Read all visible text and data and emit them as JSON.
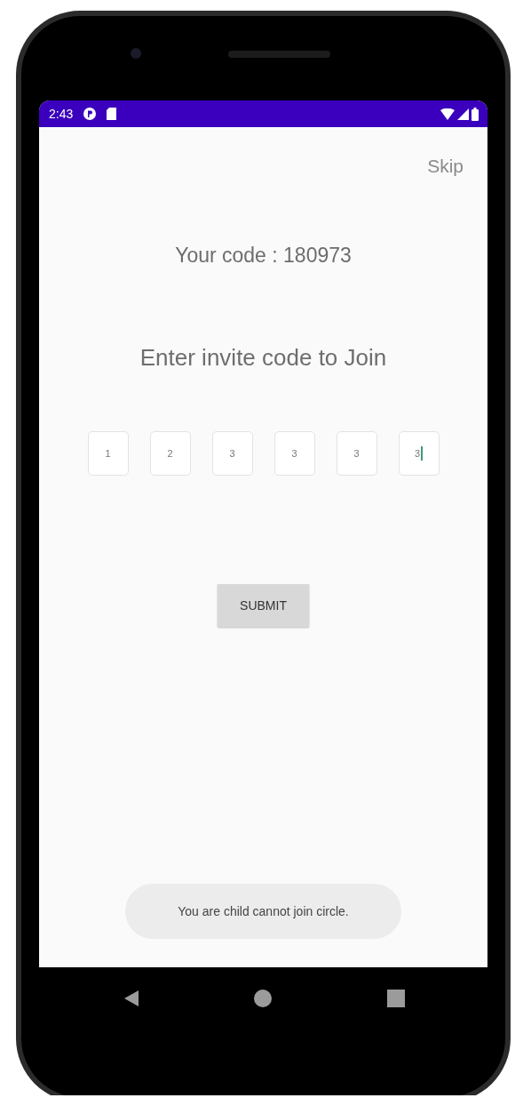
{
  "status_bar": {
    "time": "2:43"
  },
  "skip_link": "Skip",
  "your_code": "Your code :  180973",
  "prompt": "Enter invite code to Join",
  "code_boxes": [
    {
      "value": "1",
      "focused": false
    },
    {
      "value": "2",
      "focused": false
    },
    {
      "value": "3",
      "focused": false
    },
    {
      "value": "3",
      "focused": false
    },
    {
      "value": "3",
      "focused": false
    },
    {
      "value": "3",
      "focused": true
    }
  ],
  "submit_button": "SUBMIT",
  "toast": "You are child cannot join circle."
}
